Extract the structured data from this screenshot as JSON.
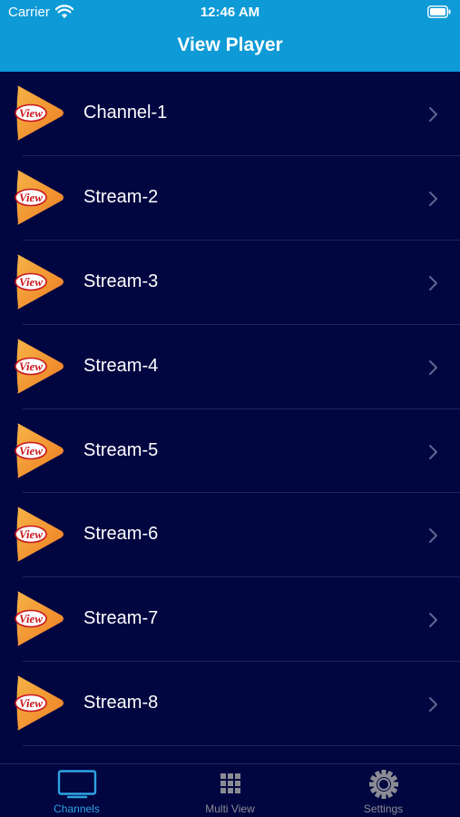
{
  "status_bar": {
    "carrier": "Carrier",
    "time": "12:46 AM"
  },
  "header": {
    "title": "View Player"
  },
  "channels": [
    {
      "label": "Channel-1",
      "logo_text": "View"
    },
    {
      "label": "Stream-2",
      "logo_text": "View"
    },
    {
      "label": "Stream-3",
      "logo_text": "View"
    },
    {
      "label": "Stream-4",
      "logo_text": "View"
    },
    {
      "label": "Stream-5",
      "logo_text": "View"
    },
    {
      "label": "Stream-6",
      "logo_text": "View"
    },
    {
      "label": "Stream-7",
      "logo_text": "View"
    },
    {
      "label": "Stream-8",
      "logo_text": "View"
    }
  ],
  "tabs": [
    {
      "label": "Channels",
      "icon": "tv-icon",
      "active": true
    },
    {
      "label": "Multi View",
      "icon": "grid-icon",
      "active": false
    },
    {
      "label": "Settings",
      "icon": "gear-icon",
      "active": false
    }
  ],
  "colors": {
    "header": "#0d9ad6",
    "background": "#010540",
    "accent": "#2da3e2",
    "inactive": "#8b8b94",
    "logo_orange": "#f39a2b"
  }
}
